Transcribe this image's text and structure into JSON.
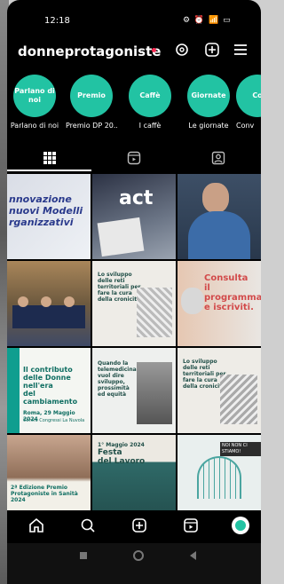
{
  "status": {
    "time": "12:18",
    "icons": "⚙ ⏰ 📶 ▭"
  },
  "header": {
    "username": "donneprotagoniste",
    "chevron": "⌄"
  },
  "highlights": [
    {
      "label": "Parlano di noi",
      "caption": "Parlano di noi"
    },
    {
      "label": "Premio",
      "caption": "Premio DP 20..."
    },
    {
      "label": "Caffè",
      "caption": "I caffè"
    },
    {
      "label": "Giornate",
      "caption": "Le giornate"
    },
    {
      "label": "Co",
      "caption": "Conv"
    }
  ],
  "posts": {
    "p1": {
      "lines": [
        "nnovazione",
        "nuovi Modelli",
        "rganizzativi"
      ]
    },
    "p2": {
      "text": "act"
    },
    "p4": {
      "text": ""
    },
    "p5": {
      "lines": [
        "Lo sviluppo",
        "delle reti",
        "territoriali per",
        "fare la cura",
        "della cronicità"
      ]
    },
    "p6": {
      "lines": [
        "Consulta",
        "il programma",
        "e iscriviti."
      ]
    },
    "p7": {
      "lines": [
        "Il contributo",
        "delle Donne",
        "nell'era",
        "del",
        "cambiamento"
      ],
      "footer": "Roma, 29 Maggio 2024",
      "sub": "Centro Congressi La Nuvola"
    },
    "p8": {
      "lines": [
        "Quando la",
        "telemedicina",
        "vuol dire",
        "sviluppo,",
        "prossimità",
        "ed equità"
      ]
    },
    "p9": {
      "lines": [
        "Lo sviluppo",
        "delle reti",
        "territoriali per",
        "fare la cura",
        "della cronicità"
      ]
    },
    "p10": {
      "lines": [
        "2ª Edizione Premio",
        "Protagoniste in Sanità 2024"
      ]
    },
    "p11": {
      "lines": [
        "1° Maggio 2024",
        "Festa",
        "del Lavoro"
      ]
    },
    "p12": {
      "text": "NOI NON CI STIAMO!"
    }
  },
  "colors": {
    "accent": "#22c3a3",
    "notification": "#ff2d55"
  }
}
